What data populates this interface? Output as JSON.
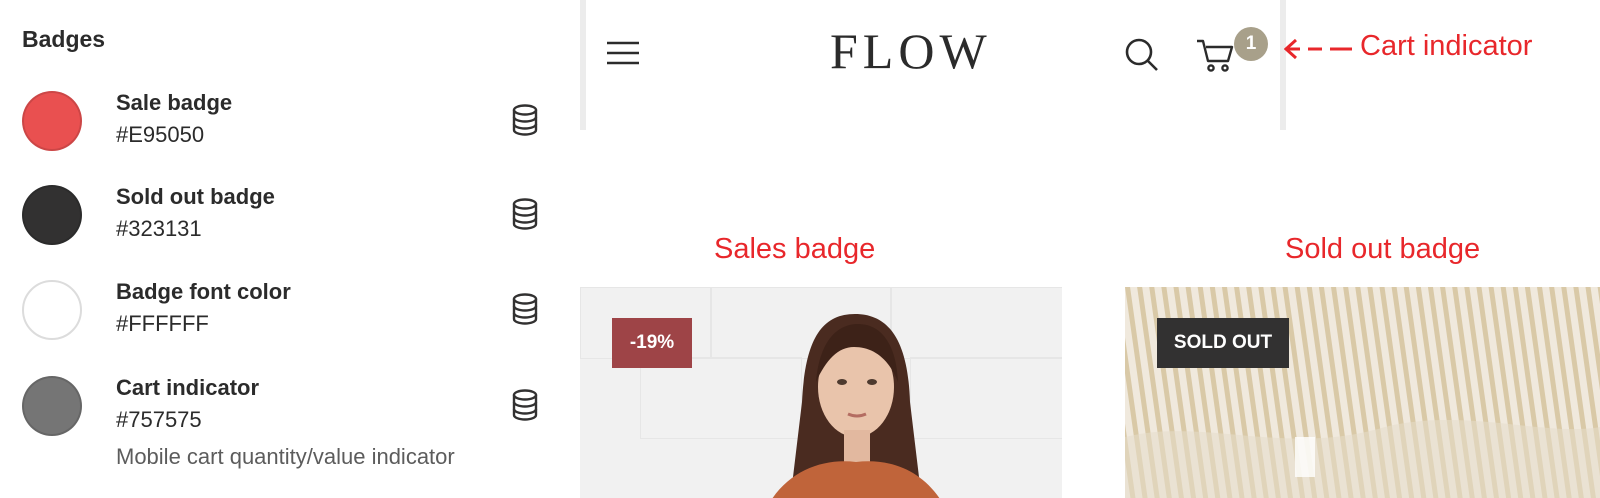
{
  "panel": {
    "title": "Badges",
    "items": [
      {
        "name": "Sale badge",
        "hex": "#E95050",
        "color": "#E95050",
        "description": ""
      },
      {
        "name": "Sold out badge",
        "hex": "#323131",
        "color": "#323131",
        "description": ""
      },
      {
        "name": "Badge font color",
        "hex": "#FFFFFF",
        "color": "#FFFFFF",
        "description": ""
      },
      {
        "name": "Cart indicator",
        "hex": "#757575",
        "color": "#757575",
        "description": "Mobile cart quantity/value indicator"
      }
    ],
    "item_icon": "database-icon"
  },
  "preview": {
    "logo": "FLOW",
    "cart_count": "1",
    "icons": [
      "hamburger-menu-icon",
      "search-icon",
      "cart-icon"
    ],
    "products": [
      {
        "badge": "-19%",
        "badge_color": "#9E4447"
      },
      {
        "badge": "SOLD OUT",
        "badge_color": "#323131"
      }
    ]
  },
  "annotations": {
    "cart_indicator": "Cart indicator",
    "sales_badge": "Sales badge",
    "sold_out_badge": "Sold out badge",
    "color": "#E8272B"
  }
}
